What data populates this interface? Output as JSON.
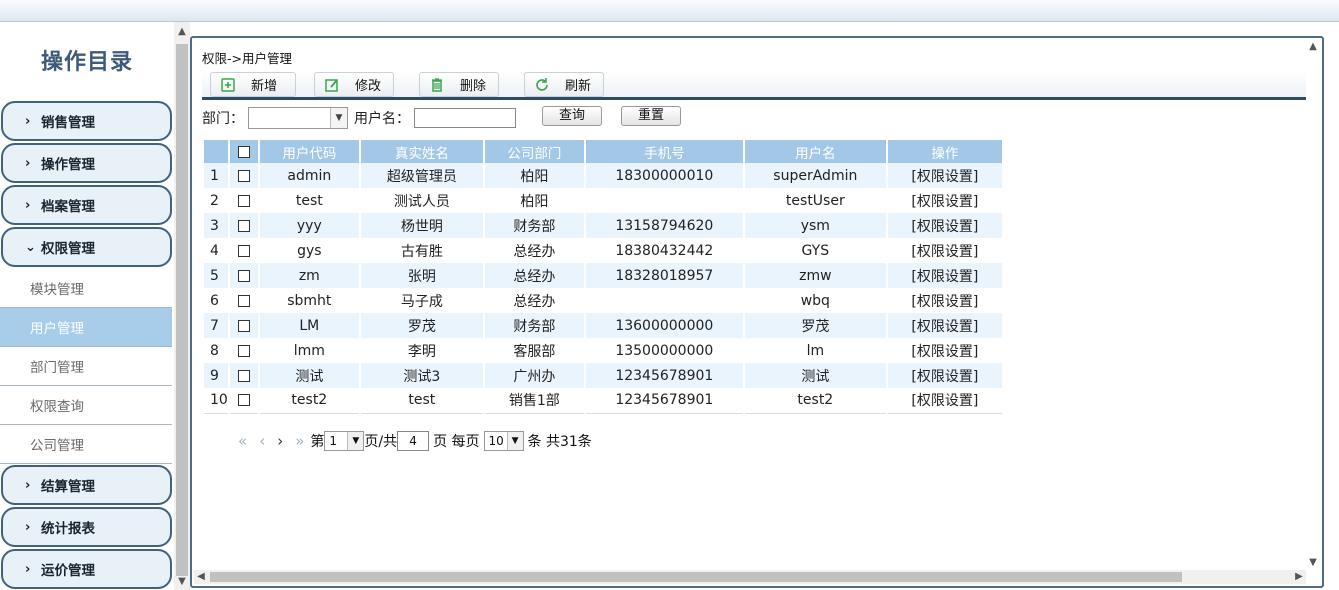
{
  "sidebar": {
    "title": "操作目录",
    "groups": [
      {
        "label": "销售管理",
        "chevron": "›"
      },
      {
        "label": "操作管理",
        "chevron": "›"
      },
      {
        "label": "档案管理",
        "chevron": "›"
      },
      {
        "label": "权限管理",
        "chevron": "⌄"
      },
      {
        "label": "结算管理",
        "chevron": "›"
      },
      {
        "label": "统计报表",
        "chevron": "›"
      },
      {
        "label": "运价管理",
        "chevron": "›"
      }
    ],
    "sub_items": [
      {
        "label": "模块管理"
      },
      {
        "label": "用户管理"
      },
      {
        "label": "部门管理"
      },
      {
        "label": "权限查询"
      },
      {
        "label": "公司管理"
      }
    ],
    "active_sub": "用户管理"
  },
  "main": {
    "breadcrumb": "权限->用户管理",
    "toolbar": {
      "add_label": "新增",
      "edit_label": "修改",
      "delete_label": "删除",
      "refresh_label": "刷新",
      "add_icon": "add-file-icon",
      "edit_icon": "edit-icon",
      "delete_icon": "trash-icon",
      "refresh_icon": "refresh-icon"
    },
    "filter": {
      "dept_label": "部门：",
      "dept_value": "",
      "username_label": "用户名：",
      "username_value": "",
      "query_label": "查询",
      "reset_label": "重置"
    },
    "table": {
      "columns": [
        "用户代码",
        "真实姓名",
        "公司部门",
        "手机号",
        "用户名",
        "操作"
      ],
      "rows": [
        {
          "no": "1",
          "code": "admin",
          "name": "超级管理员",
          "dept": "柏阳",
          "phone": "18300000010",
          "user": "superAdmin",
          "op": "[权限设置]"
        },
        {
          "no": "2",
          "code": "test",
          "name": "测试人员",
          "dept": "柏阳",
          "phone": "",
          "user": "testUser",
          "op": "[权限设置]"
        },
        {
          "no": "3",
          "code": "yyy",
          "name": "杨世明",
          "dept": "财务部",
          "phone": "13158794620",
          "user": "ysm",
          "op": "[权限设置]"
        },
        {
          "no": "4",
          "code": "gys",
          "name": "古有胜",
          "dept": "总经办",
          "phone": "18380432442",
          "user": "GYS",
          "op": "[权限设置]"
        },
        {
          "no": "5",
          "code": "zm",
          "name": "张明",
          "dept": "总经办",
          "phone": "18328018957",
          "user": "zmw",
          "op": "[权限设置]"
        },
        {
          "no": "6",
          "code": "sbmht",
          "name": "马子成",
          "dept": "总经办",
          "phone": "",
          "user": "wbq",
          "op": "[权限设置]"
        },
        {
          "no": "7",
          "code": "LM",
          "name": "罗茂",
          "dept": "财务部",
          "phone": "13600000000",
          "user": "罗茂",
          "op": "[权限设置]"
        },
        {
          "no": "8",
          "code": "lmm",
          "name": "李明",
          "dept": "客服部",
          "phone": "13500000000",
          "user": "lm",
          "op": "[权限设置]"
        },
        {
          "no": "9",
          "code": "测试",
          "name": "测试3",
          "dept": "广州办",
          "phone": "12345678901",
          "user": "测试",
          "op": "[权限设置]"
        },
        {
          "no": "10",
          "code": "test2",
          "name": "test",
          "dept": "销售1部",
          "phone": "12345678901",
          "user": "test2",
          "op": "[权限设置]"
        }
      ]
    },
    "pager": {
      "page_prefix": "第",
      "current_page": "1",
      "page_mid": "页/共",
      "total_pages": "4",
      "page_suffix": "页 每页",
      "page_size": "10",
      "total_text": "条 共31条"
    }
  },
  "colors": {
    "accent": "#41617f",
    "header_bg": "#a3c7e6",
    "row_alt": "#eaf4fc",
    "active_item": "#a8cdea"
  }
}
